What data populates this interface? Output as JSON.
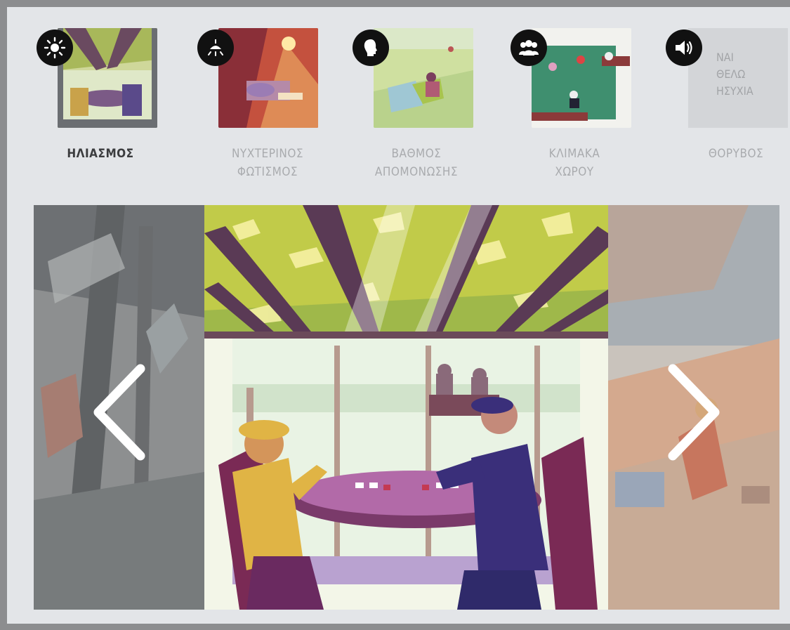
{
  "categories": [
    {
      "id": "sunlight",
      "icon": "sun-icon",
      "label": "ΗΛΙΑΣΜΟΣ",
      "active": true
    },
    {
      "id": "night-light",
      "icon": "lamp-icon",
      "label": "ΝΥΧΤΕΡΙΝΟΣ\nΦΩΤΙΣΜΟΣ",
      "active": false
    },
    {
      "id": "isolation",
      "icon": "head-icon",
      "label": "ΒΑΘΜΟΣ\nΑΠΟΜΟΝΩΣΗΣ",
      "active": false
    },
    {
      "id": "scale",
      "icon": "people-icon",
      "label": "ΚΛΙΜΑΚΑ\nΧΩΡΟΥ",
      "active": false
    },
    {
      "id": "noise",
      "icon": "speaker-icon",
      "label": "ΘΟΡΥΒΟΣ",
      "active": false,
      "preview_text": "ΝΑΙ\nΘΕΛΩ\nΗΣΥΧΙΑ"
    }
  ],
  "colors": {
    "frame": "#8c8d8f",
    "panel": "#e3e5e8",
    "active_label": "#3b3c3e",
    "inactive_label": "#a9abae",
    "badge": "#111111"
  },
  "carousel": {
    "prev_icon": "chevron-left-icon",
    "next_icon": "chevron-right-icon"
  }
}
